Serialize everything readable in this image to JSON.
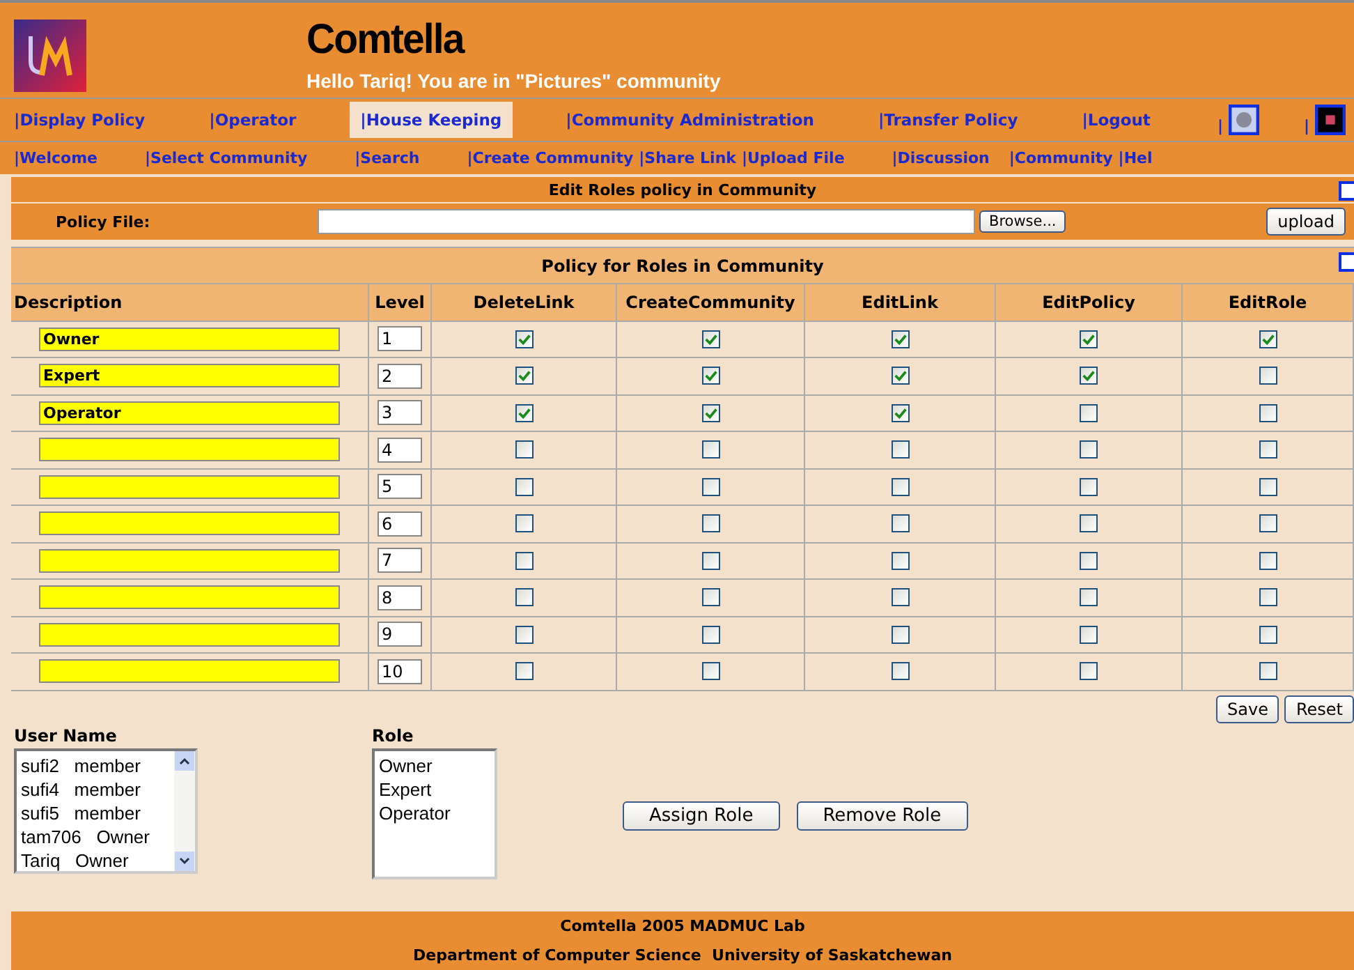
{
  "header": {
    "title": "Comtella",
    "greeting": "Hello Tariq! You are in \"Pictures\" community"
  },
  "nav_primary": [
    {
      "kind": "text",
      "label": "|Display Policy",
      "selected": false
    },
    {
      "kind": "text",
      "label": "|Operator",
      "selected": false
    },
    {
      "kind": "text",
      "label": "|House Keeping",
      "selected": true
    },
    {
      "kind": "text",
      "label": "|Community Administration",
      "selected": false
    },
    {
      "kind": "text",
      "label": "|Transfer Policy",
      "selected": false
    },
    {
      "kind": "text",
      "label": "|Logout",
      "selected": false
    },
    {
      "kind": "icon",
      "label": "|",
      "selected": false
    },
    {
      "kind": "icon",
      "label": "|",
      "selected": false
    }
  ],
  "nav_secondary": [
    "|Welcome",
    "|Select Community",
    "|Search",
    "|Create Community",
    "|Share Link",
    "|Upload File",
    "|Discussion",
    "|Community",
    "|Hel"
  ],
  "edit_section": {
    "checked": false,
    "title": "Edit Roles policy in Community",
    "file_label": "Policy File:",
    "browse": "Browse...",
    "upload": "upload"
  },
  "policy_table": {
    "checked": false,
    "title": "Policy for Roles in Community",
    "columns": [
      "Description",
      "Level",
      "DeleteLink",
      "CreateCommunity",
      "EditLink",
      "EditPolicy",
      "EditRole"
    ],
    "rows": [
      {
        "description": "Owner",
        "level": "1",
        "perms": [
          true,
          true,
          true,
          true,
          true
        ]
      },
      {
        "description": "Expert",
        "level": "2",
        "perms": [
          true,
          true,
          true,
          true,
          false
        ]
      },
      {
        "description": "Operator",
        "level": "3",
        "perms": [
          true,
          true,
          true,
          false,
          false
        ]
      },
      {
        "description": "",
        "level": "4",
        "perms": [
          false,
          false,
          false,
          false,
          false
        ]
      },
      {
        "description": "",
        "level": "5",
        "perms": [
          false,
          false,
          false,
          false,
          false
        ]
      },
      {
        "description": "",
        "level": "6",
        "perms": [
          false,
          false,
          false,
          false,
          false
        ]
      },
      {
        "description": "",
        "level": "7",
        "perms": [
          false,
          false,
          false,
          false,
          false
        ]
      },
      {
        "description": "",
        "level": "8",
        "perms": [
          false,
          false,
          false,
          false,
          false
        ]
      },
      {
        "description": "",
        "level": "9",
        "perms": [
          false,
          false,
          false,
          false,
          false
        ]
      },
      {
        "description": "",
        "level": "10",
        "perms": [
          false,
          false,
          false,
          false,
          false
        ]
      }
    ],
    "buttons": [
      "Save",
      "Reset"
    ]
  },
  "assignment": {
    "user_label": "User Name",
    "users": [
      {
        "name": "sufi2",
        "role": "member"
      },
      {
        "name": "sufi4",
        "role": "member"
      },
      {
        "name": "sufi5",
        "role": "member"
      },
      {
        "name": "tam706",
        "role": "Owner"
      },
      {
        "name": "Tariq",
        "role": "Owner"
      }
    ],
    "role_label": "Role",
    "roles": [
      "Owner",
      "Expert",
      "Operator"
    ],
    "buttons": [
      "Assign Role",
      "Remove Role"
    ]
  },
  "footer": [
    "Comtella 2005 MADMUC Lab",
    "Department of Computer Science  University of Saskatchewan"
  ]
}
